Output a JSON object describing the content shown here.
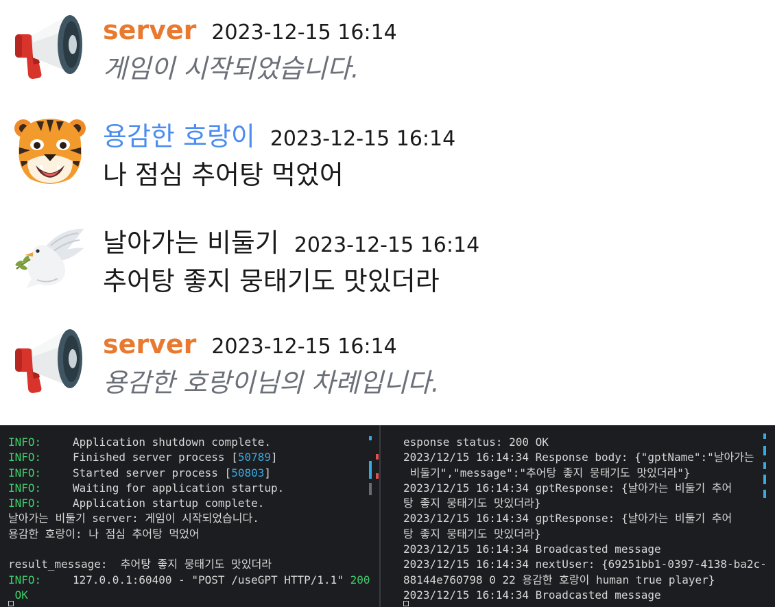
{
  "chat": {
    "messages": [
      {
        "author": "server",
        "timestamp": "2023-12-15 16:14",
        "text": "게임이 시작되었습니다.",
        "avatar": "megaphone-icon"
      },
      {
        "author": "용감한 호랑이",
        "timestamp": "2023-12-15 16:14",
        "text": "나 점심 추어탕 먹었어",
        "avatar": "tiger-icon"
      },
      {
        "author": "날아가는 비둘기",
        "timestamp": "2023-12-15 16:14",
        "text": "추어탕 좋지 뭉태기도 맛있더라",
        "avatar": "dove-icon"
      },
      {
        "author": "server",
        "timestamp": "2023-12-15 16:14",
        "text": "용감한 호랑이님의 차례입니다.",
        "avatar": "megaphone-icon"
      }
    ]
  },
  "terminal": {
    "left": {
      "level": "INFO:",
      "l1": "Application shutdown complete.",
      "l2_text": "Finished server process [",
      "l2_pid": "50789",
      "l3_text": "Started server process [",
      "l3_pid": "50803",
      "l4": "Waiting for application startup.",
      "l5": "Application startup complete.",
      "l6": "날아가는 비둘기 server: 게임이 시작되었습니다.",
      "l7": "용감한 호랑이: 나 점심 추어탕 먹었어",
      "l9": "result_message:  추어탕 좋지 뭉태기도 맛있더라",
      "l10_text": "127.0.0.1:60400 - \"POST /useGPT HTTP/1.1\" ",
      "l10_code": "200",
      "l11": " OK"
    },
    "right": {
      "lines": [
        "esponse status: 200 OK",
        "2023/12/15 16:14:34 Response body: {\"gptName\":\"날아가는",
        " 비둘기\",\"message\":\"추어탕 좋지 뭉태기도 맛있더라\"}",
        "2023/12/15 16:14:34 gptResponse: {날아가는 비둘기 추어",
        "탕 좋지 뭉태기도 맛있더라}",
        "2023/12/15 16:14:34 gptResponse: {날아가는 비둘기 추어",
        "탕 좋지 뭉태기도 맛있더라}",
        "2023/12/15 16:14:34 Broadcasted message",
        "2023/12/15 16:14:34 nextUser: {69251bb1-0397-4138-ba2c-",
        "88144e760798 0 22 용감한 호랑이 human true player}",
        "2023/12/15 16:14:34 Broadcasted message"
      ]
    }
  },
  "colors": {
    "server_name": "#e8792f",
    "tiger_name": "#4a8cf0",
    "system_text": "#6b6f78",
    "terminal_bg": "#1c1d20",
    "log_level": "#3fd06d",
    "pid": "#3aa9e0"
  }
}
